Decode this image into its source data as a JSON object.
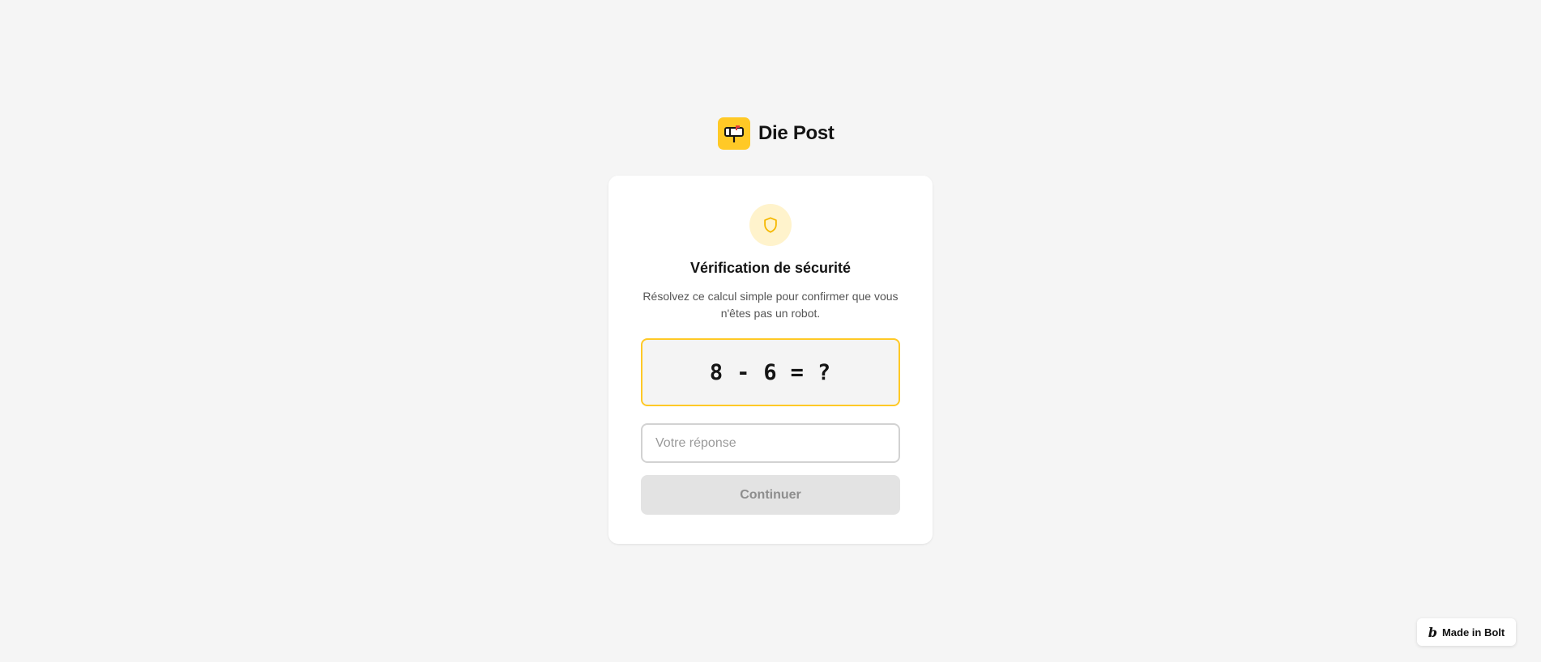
{
  "brand": {
    "name": "Die Post",
    "logo_icon": "mailbox-icon",
    "accent_color": "#ffc926"
  },
  "card": {
    "icon": "shield-icon",
    "title": "Vérification de sécurité",
    "subtitle": "Résolvez ce calcul simple pour confirmer que vous n'êtes pas un robot.",
    "equation": {
      "a": "8",
      "operator": "-",
      "b": "6",
      "equals": "=",
      "unknown": "?"
    },
    "answer_input": {
      "value": "",
      "placeholder": "Votre réponse"
    },
    "continue_label": "Continuer"
  },
  "badge": {
    "icon": "bolt-b-icon",
    "label": "Made in Bolt"
  }
}
